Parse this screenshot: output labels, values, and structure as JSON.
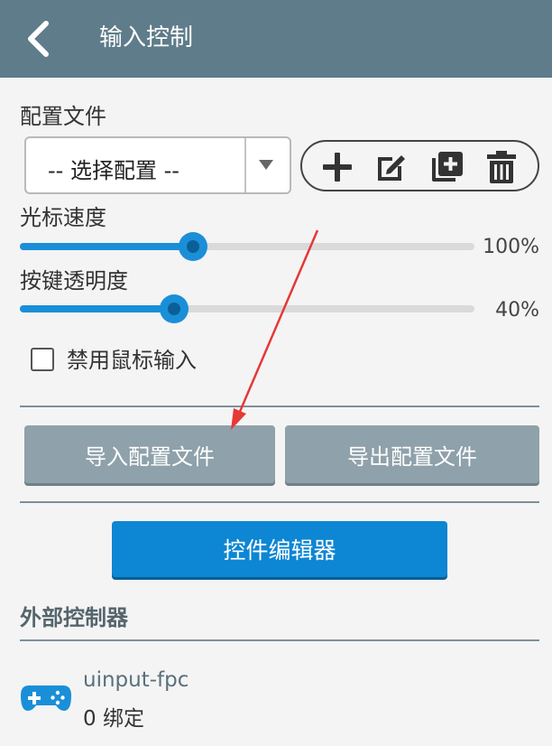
{
  "appbar": {
    "title": "输入控制",
    "back_icon": "chevron-left-icon"
  },
  "profile": {
    "label": "配置文件",
    "select_value": "-- 选择配置 --",
    "actions": [
      {
        "name": "add",
        "icon": "plus-icon"
      },
      {
        "name": "edit",
        "icon": "edit-icon"
      },
      {
        "name": "duplicate",
        "icon": "copy-add-icon"
      },
      {
        "name": "delete",
        "icon": "trash-icon"
      }
    ]
  },
  "sliders": [
    {
      "label": "光标速度",
      "value_text": "100%",
      "fraction": 0.38
    },
    {
      "label": "按键透明度",
      "value_text": "40%",
      "fraction": 0.34
    }
  ],
  "checkbox": {
    "label": "禁用鼠标输入",
    "checked": false
  },
  "buttons": {
    "import": "导入配置文件",
    "export": "导出配置文件",
    "editor": "控件编辑器"
  },
  "external": {
    "section_title": "外部控制器",
    "devices": [
      {
        "name": "uinput-fpc",
        "binding": "0 绑定",
        "icon": "gamepad-icon"
      }
    ]
  },
  "colors": {
    "appbar": "#5f7c8a",
    "accent": "#0d86d3",
    "grey_button": "#8fa1aa",
    "annotation_arrow": "#e53935"
  }
}
